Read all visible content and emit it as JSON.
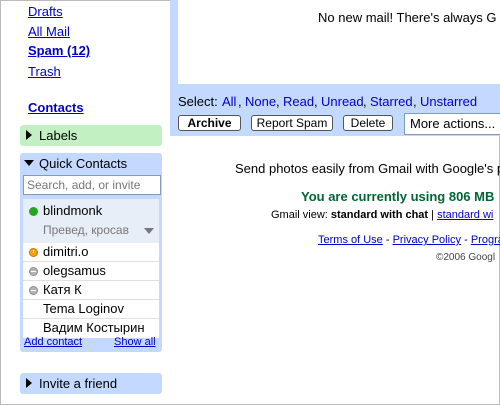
{
  "nav": {
    "drafts": "Drafts",
    "all_mail": "All Mail",
    "spam": "Spam (12)",
    "trash": "Trash",
    "contacts": "Contacts"
  },
  "labels_box": {
    "label": "Labels"
  },
  "quick_contacts": {
    "title": "Quick Contacts",
    "search_placeholder": "Search, add, or invite",
    "self": {
      "name": "blindmonk",
      "status": "Превед, кросав"
    },
    "contacts": [
      {
        "name": "dimitri.o",
        "status": "idle"
      },
      {
        "name": "olegsamus",
        "status": "offline"
      },
      {
        "name": "Катя К",
        "status": "offline"
      },
      {
        "name": "Tema Loginov",
        "status": "none"
      },
      {
        "name": "Вадим Костырин",
        "status": "none"
      }
    ],
    "add_contact": "Add contact",
    "show_all": "Show all"
  },
  "invite_box": {
    "label": "Invite a friend"
  },
  "main": {
    "no_mail_text": "No new mail! There's always G",
    "select_label": "Select:",
    "select_options": [
      "All",
      "Nоne",
      "Read",
      "Unread",
      "Starred",
      "Unstarred"
    ],
    "buttons": {
      "archive": "Archive",
      "report_spam": "Report Spam",
      "delete": "Delete"
    },
    "more_actions": "More actions...",
    "promo_text": "Send photos easily from Gmail with Google's p",
    "storage_text": "You are currently using 806 MB",
    "gmail_view_label": "Gmail view:",
    "gmail_view_current": "standard with chat",
    "gmail_view_separator": "|",
    "gmail_view_alt": "standard wi",
    "footer": {
      "terms": "Terms of Use",
      "sep1": " - ",
      "privacy": "Privacy Policy",
      "sep2": " - ",
      "program": "Progra"
    },
    "copyright": "©2006 Googl"
  },
  "colors": {
    "link": "#0000cc",
    "panel_blue": "#c3d9ff",
    "labels_green": "#c3f0c3",
    "storage_green": "#006633"
  }
}
